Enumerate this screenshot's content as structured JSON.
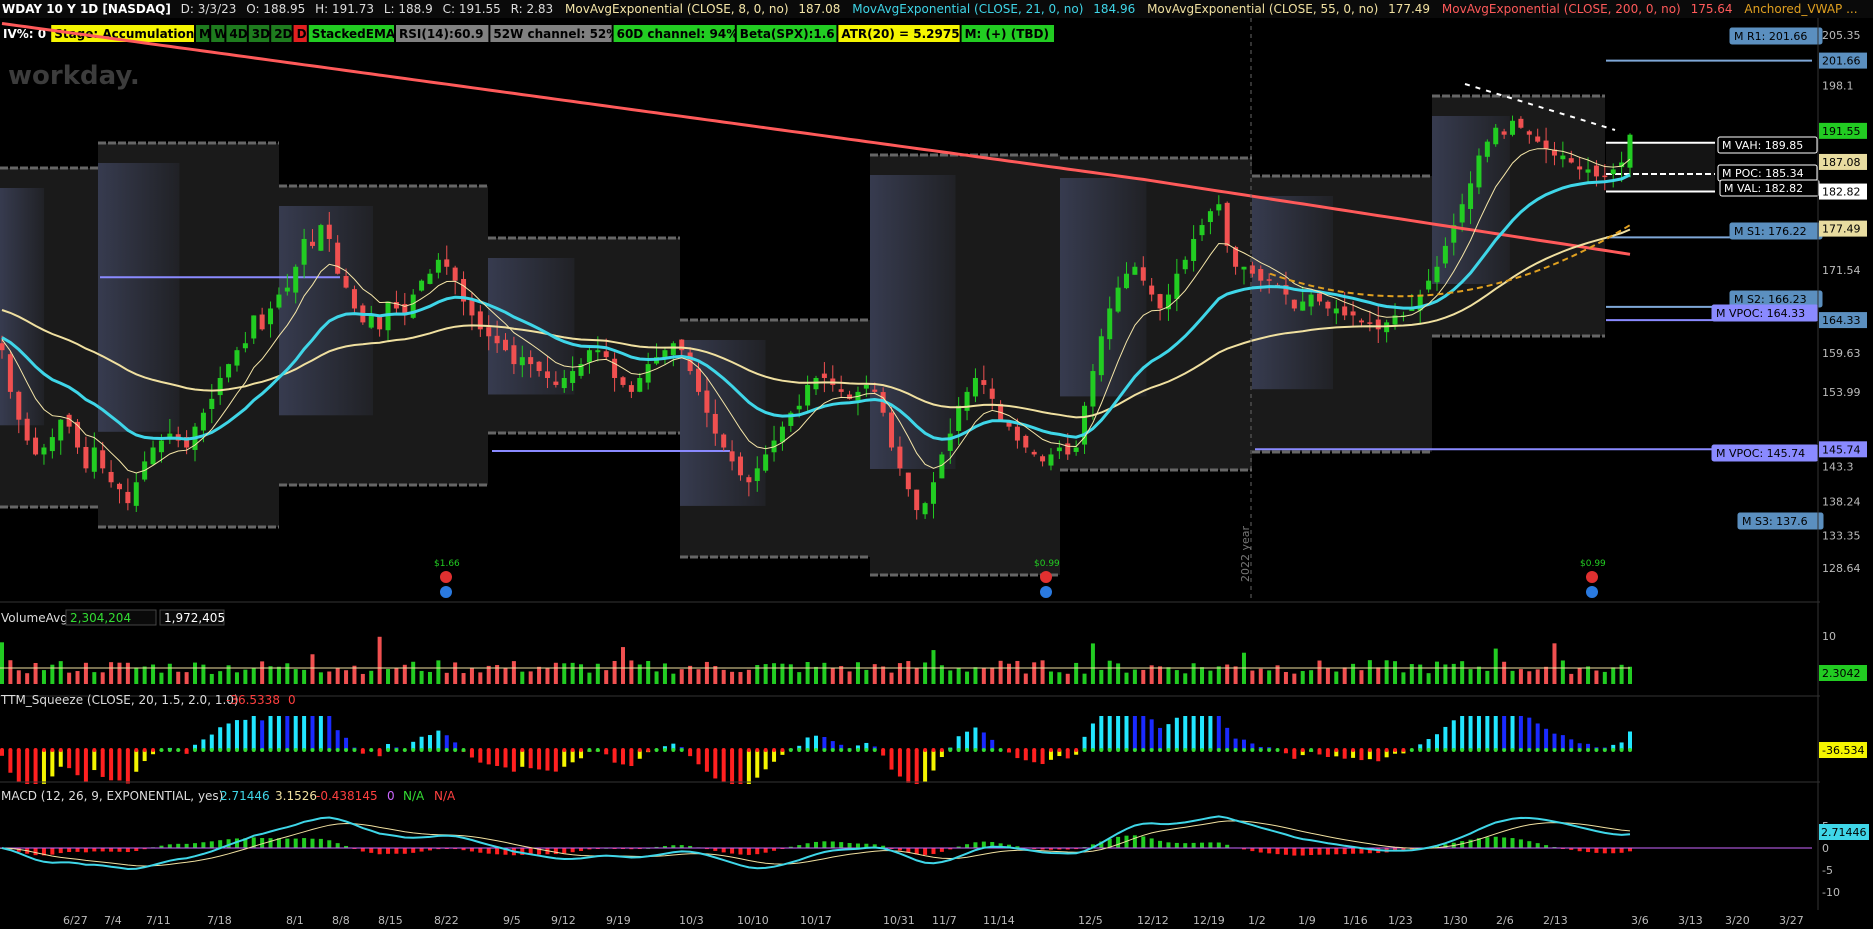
{
  "header": {
    "symbol": "WDAY 10 Y 1D [NASDAQ]",
    "date": "D: 3/3/23",
    "open": "O: 188.95",
    "high": "H: 191.73",
    "low": "L: 188.9",
    "close": "C: 191.55",
    "range": "R: 2.83",
    "studies": [
      {
        "label": "MovAvgExponential (CLOSE, 8, 0, no)",
        "value": "187.08",
        "color": "#f5e6a8"
      },
      {
        "label": "MovAvgExponential (CLOSE, 21, 0, no)",
        "value": "184.96",
        "color": "#3fd6e8"
      },
      {
        "label": "MovAvgExponential (CLOSE, 55, 0, no)",
        "value": "177.49",
        "color": "#f0e0a0"
      },
      {
        "label": "MovAvgExponential (CLOSE, 200, 0, no)",
        "value": "175.64",
        "color": "#ff5a5a"
      },
      {
        "label": "Anchored_VWAP ...",
        "value": "",
        "color": "#e0a020"
      }
    ]
  },
  "badges": [
    {
      "text": "IV%: 0",
      "bg": "#000000",
      "fg": "#ffffff"
    },
    {
      "text": "Stage: Accumulation",
      "bg": "#f5f500",
      "fg": "#000000"
    },
    {
      "text": "M",
      "bg": "#1e7b1e",
      "fg": "#000000"
    },
    {
      "text": "W",
      "bg": "#1e7b1e",
      "fg": "#000000"
    },
    {
      "text": "4D",
      "bg": "#1e7b1e",
      "fg": "#000000"
    },
    {
      "text": "3D",
      "bg": "#1e7b1e",
      "fg": "#000000"
    },
    {
      "text": "2D",
      "bg": "#1e7b1e",
      "fg": "#000000"
    },
    {
      "text": "D",
      "bg": "#e02020",
      "fg": "#000000"
    },
    {
      "text": "StackedEMAs",
      "bg": "#22cc22",
      "fg": "#000000"
    },
    {
      "text": "RSI(14):60.9",
      "bg": "#808080",
      "fg": "#000000"
    },
    {
      "text": "52W channel: 52%",
      "bg": "#808080",
      "fg": "#000000"
    },
    {
      "text": "60D channel: 94%",
      "bg": "#22cc22",
      "fg": "#000000"
    },
    {
      "text": "Beta(SPX):1.6",
      "bg": "#22cc22",
      "fg": "#000000"
    },
    {
      "text": "ATR(20) = 5.2975",
      "bg": "#f5f500",
      "fg": "#000000"
    },
    {
      "text": "M: (+) (TBD)",
      "bg": "#22cc22",
      "fg": "#000000"
    }
  ],
  "watermark": "workday.",
  "year_marker": "2022 year",
  "chart_data": [
    {
      "type": "candlestick",
      "title": "WDAY 10 Y 1D [NASDAQ]",
      "y_ticks": [
        "205.35",
        "198.1",
        "171.54",
        "159.63",
        "153.99",
        "143.3",
        "138.24",
        "133.35",
        "128.64"
      ],
      "ylim": [
        125.5,
        207.5
      ],
      "x_ticks": [
        "6/27",
        "7/4",
        "7/11",
        "7/18",
        "8/1",
        "8/8",
        "8/15",
        "8/22",
        "9/5",
        "9/12",
        "9/19",
        "10/3",
        "10/10",
        "10/17",
        "10/31",
        "11/7",
        "11/14",
        "12/5",
        "12/12",
        "12/19",
        "1/2",
        "1/9",
        "1/16",
        "1/23",
        "1/30",
        "2/6",
        "2/13",
        "3/6",
        "3/13",
        "3/20",
        "3/27"
      ],
      "closes": [
        160,
        154,
        150,
        147,
        145,
        146,
        147.5,
        150,
        149,
        146,
        143,
        146,
        143,
        141,
        140,
        138,
        141,
        144,
        146,
        147,
        148,
        147,
        146,
        149,
        151,
        153,
        156,
        158,
        160,
        161,
        165,
        163,
        166,
        168,
        169,
        172,
        176,
        175,
        178,
        176,
        171,
        169,
        166,
        164,
        165,
        163,
        167,
        166,
        165,
        168,
        170,
        171,
        173,
        172,
        170,
        167,
        165,
        163,
        162,
        161,
        160,
        158,
        159,
        158,
        157,
        156,
        155,
        156,
        157,
        158,
        160,
        160,
        159,
        156,
        155,
        154,
        156,
        158,
        159,
        160,
        161,
        160,
        157,
        154,
        151,
        148,
        146,
        144,
        142,
        141,
        143,
        145,
        147,
        149,
        151,
        152,
        155,
        156,
        156,
        155,
        154,
        153,
        154,
        155,
        154,
        151,
        146,
        143,
        140,
        137,
        138,
        141,
        145,
        148,
        152,
        154,
        156,
        155,
        153,
        150,
        149,
        147,
        146,
        145,
        144,
        145,
        146,
        145,
        146,
        152,
        157,
        162,
        166,
        169,
        171,
        172,
        170,
        168,
        166,
        168,
        171,
        173,
        176,
        178,
        180,
        181,
        175,
        172,
        172,
        171,
        170,
        170,
        169,
        168,
        166,
        167,
        168,
        167,
        166,
        166,
        165,
        165,
        164,
        164,
        163,
        164,
        165,
        165,
        166,
        168,
        170,
        172,
        175,
        178,
        181,
        184,
        188,
        190,
        192,
        191,
        193,
        192,
        191,
        190,
        189,
        188,
        188,
        187,
        186,
        186,
        185,
        185,
        186,
        187,
        191
      ],
      "price_labels": [
        {
          "text": "201.66",
          "value": 201.66,
          "bg": "#5b8fbf"
        },
        {
          "text": "191.55",
          "value": 191.55,
          "bg": "#22cc22"
        },
        {
          "text": "187.08",
          "value": 187.08,
          "bg": "#e8dca0"
        },
        {
          "text": "182.82",
          "value": 182.82,
          "bg": "#ffffff"
        },
        {
          "text": "177.49",
          "value": 177.49,
          "bg": "#e8dca0"
        },
        {
          "text": "164.33",
          "value": 164.33,
          "bg": "#5b8fbf"
        },
        {
          "text": "145.74",
          "value": 145.74,
          "bg": "#8a8aff"
        }
      ],
      "level_labels": [
        {
          "text": "M R1: 201.66",
          "value": 201.66,
          "bg": "#5b8fbf"
        },
        {
          "text": "M VAH: 189.85",
          "value": 189.85,
          "bg": "#000000"
        },
        {
          "text": "M POC: 185.34",
          "value": 185.34,
          "bg": "#000000"
        },
        {
          "text": "M VAL: 182.82",
          "value": 182.82,
          "bg": "#000000"
        },
        {
          "text": "M S1: 176.22",
          "value": 176.22,
          "bg": "#5b8fbf"
        },
        {
          "text": "M S2: 166.23",
          "value": 166.23,
          "bg": "#5b8fbf"
        },
        {
          "text": "M VPOC: 164.33",
          "value": 164.33,
          "bg": "#8a8aff"
        },
        {
          "text": "M VPOC: 145.74",
          "value": 145.74,
          "bg": "#8a8aff"
        },
        {
          "text": "M S3: 137.6",
          "value": 137.6,
          "bg": "#5b8fbf"
        }
      ],
      "dividends": [
        {
          "text": "$1.66",
          "x_label": "8/15"
        },
        {
          "text": "$0.99",
          "x_label": "11/14"
        },
        {
          "text": "$0.99",
          "x_label": "2/13"
        }
      ]
    },
    {
      "type": "bar",
      "title": "VolumeAvg (50)",
      "values_text": [
        "2,304,204",
        "1,972,405"
      ],
      "y_ticks": [
        "10"
      ],
      "last_label": "2.3042"
    },
    {
      "type": "bar",
      "title": "TTM_Squeeze (CLOSE, 20, 1.5, 2.0, 1.0)",
      "values_text": [
        "-36.5338",
        "0"
      ],
      "last_label": "-36.534"
    },
    {
      "type": "line",
      "title": "MACD (12, 26, 9, EXPONENTIAL, yes)",
      "values_text": [
        "2.71446",
        "3.1526",
        "-0.438145",
        "0",
        "N/A",
        "N/A"
      ],
      "y_ticks": [
        "5",
        "0",
        "-5",
        "-10"
      ],
      "last_label": "2.71446"
    }
  ]
}
